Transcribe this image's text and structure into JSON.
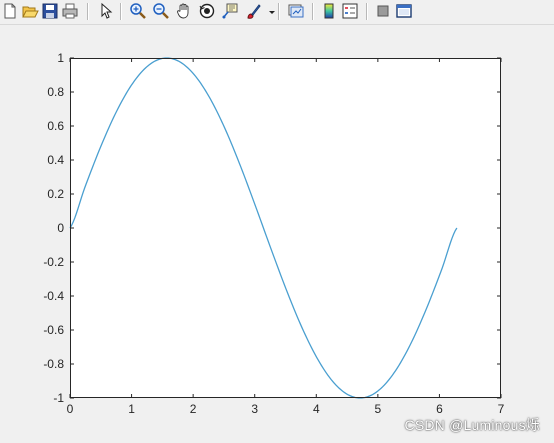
{
  "toolbar": {
    "buttons": [
      {
        "name": "new-figure-icon",
        "icon": "new-file-icon"
      },
      {
        "name": "open-file-icon",
        "icon": "folder-open-icon"
      },
      {
        "name": "save-figure-icon",
        "icon": "floppy-disk-icon"
      },
      {
        "name": "print-figure-icon",
        "icon": "printer-icon"
      },
      {
        "name": "edit-plot-icon",
        "icon": "pointer-arrow-icon"
      },
      {
        "name": "zoom-in-icon",
        "icon": "magnifier-plus-icon"
      },
      {
        "name": "zoom-out-icon",
        "icon": "magnifier-minus-icon"
      },
      {
        "name": "pan-icon",
        "icon": "hand-icon"
      },
      {
        "name": "rotate-3d-icon",
        "icon": "rotate-icon"
      },
      {
        "name": "data-cursor-icon",
        "icon": "datatip-icon"
      },
      {
        "name": "brush-icon",
        "icon": "brush-icon"
      },
      {
        "name": "link-plot-icon",
        "icon": "link-plot-icon"
      },
      {
        "name": "insert-colorbar-icon",
        "icon": "colorbar-icon"
      },
      {
        "name": "insert-legend-icon",
        "icon": "legend-icon"
      },
      {
        "name": "hide-plot-tools-icon",
        "icon": "hide-tools-icon"
      },
      {
        "name": "show-plot-tools-icon",
        "icon": "show-tools-icon"
      }
    ]
  },
  "colors": {
    "line": "#4a9fd0",
    "axes_bg": "#ffffff",
    "figure_bg": "#f0f0f0",
    "axis": "#262626",
    "tick_label": "#262626"
  },
  "chart_data": {
    "type": "line",
    "title": "",
    "xlabel": "",
    "ylabel": "",
    "xlim": [
      0,
      7
    ],
    "ylim": [
      -1,
      1
    ],
    "xticks": [
      0,
      1,
      2,
      3,
      4,
      5,
      6,
      7
    ],
    "yticks": [
      -1,
      -0.8,
      -0.6,
      -0.4,
      -0.2,
      0,
      0.2,
      0.4,
      0.6,
      0.8,
      1
    ],
    "xtick_labels": [
      "0",
      "1",
      "2",
      "3",
      "4",
      "5",
      "6",
      "7"
    ],
    "ytick_labels": [
      "-1",
      "-0.8",
      "-0.6",
      "-0.4",
      "-0.2",
      "0",
      "0.2",
      "0.4",
      "0.6",
      "0.8",
      "1"
    ],
    "grid": false,
    "series": [
      {
        "x": [
          0,
          0.2513,
          0.5027,
          0.754,
          1.0053,
          1.2566,
          1.508,
          1.7593,
          2.0106,
          2.2619,
          2.5133,
          2.7646,
          3.0159,
          3.2673,
          3.5186,
          3.7699,
          4.0212,
          4.2726,
          4.5239,
          4.7752,
          5.0265,
          5.2779,
          5.5292,
          5.7805,
          6.0319,
          6.2832
        ],
        "y": [
          0,
          0.2487,
          0.4818,
          0.6845,
          0.8443,
          0.9511,
          0.998,
          0.9823,
          0.9048,
          0.7705,
          0.5878,
          0.3681,
          0.1253,
          -0.1253,
          -0.3681,
          -0.5878,
          -0.7705,
          -0.9048,
          -0.9823,
          -0.998,
          -0.9511,
          -0.8443,
          -0.6845,
          -0.4818,
          -0.2487,
          0
        ]
      }
    ]
  },
  "watermark": "CSDN @Luminous烁"
}
